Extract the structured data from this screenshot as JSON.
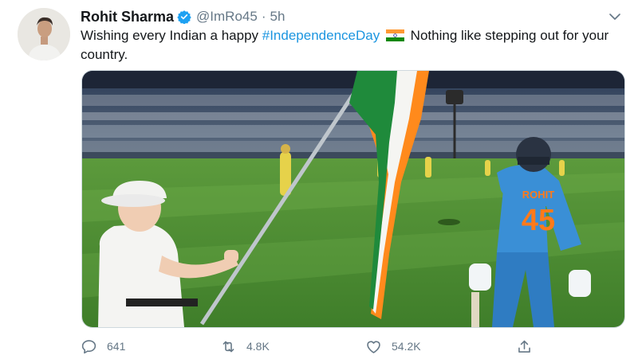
{
  "tweet": {
    "author_name": "Rohit Sharma",
    "handle": "@ImRo45",
    "separator": "·",
    "time": "5h",
    "text_before": "Wishing every Indian a happy ",
    "hashtag": "#IndependenceDay",
    "text_after": " Nothing like stepping out for your country.",
    "jersey_name": "ROHIT",
    "jersey_number": "45"
  },
  "actions": {
    "reply_count": "641",
    "retweet_count": "4.8K",
    "like_count": "54.2K"
  },
  "icons": {
    "verified": "verified-badge-icon",
    "caret": "chevron-down-icon",
    "reply": "reply-icon",
    "retweet": "retweet-icon",
    "like": "heart-icon",
    "share": "share-icon"
  },
  "colors": {
    "accent": "#1b95e0",
    "text": "#14171a",
    "muted": "#657786",
    "flag_saffron": "#ff9933",
    "flag_green": "#138808",
    "jersey_blue": "#3a8fd6"
  }
}
